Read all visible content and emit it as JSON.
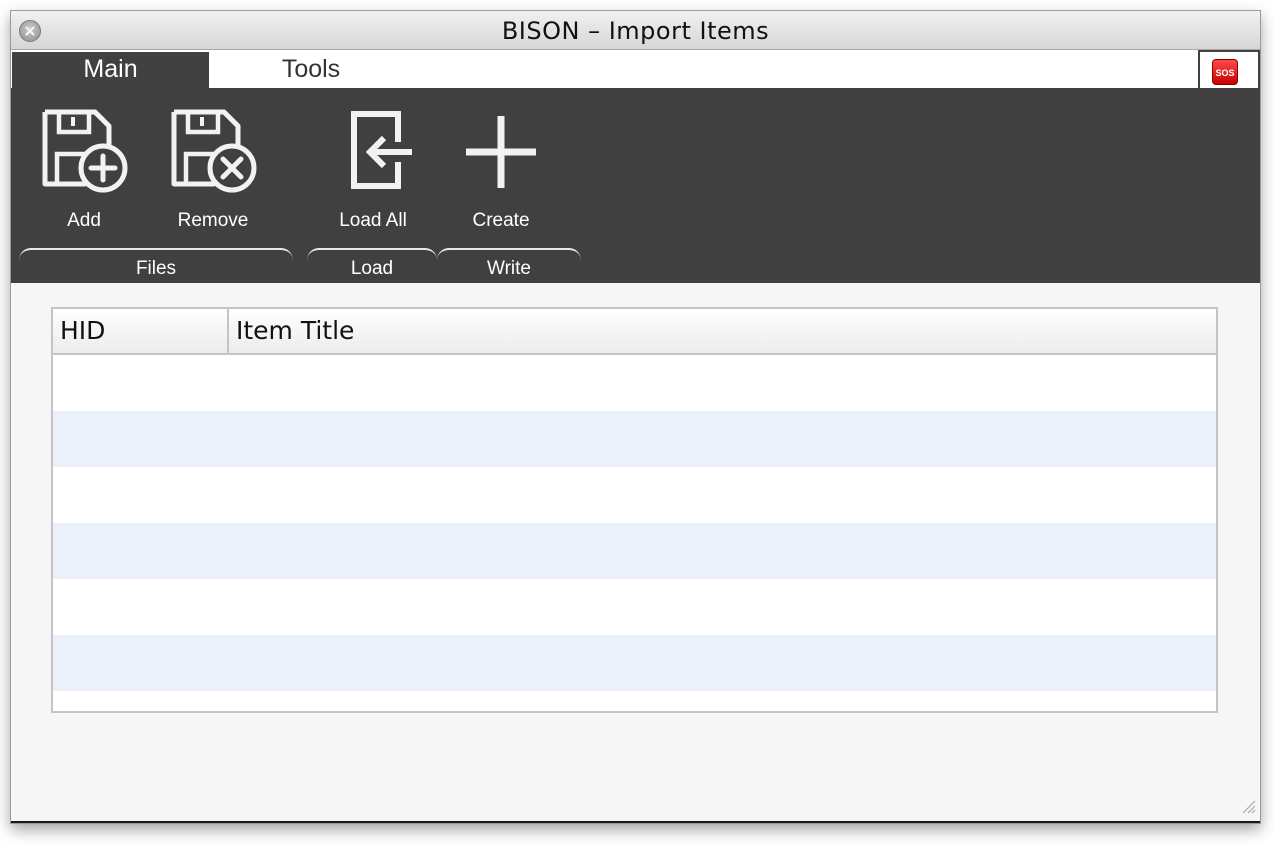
{
  "window": {
    "title": "BISON – Import Items"
  },
  "tabs": [
    {
      "label": "Main",
      "active": true
    },
    {
      "label": "Tools",
      "active": false
    }
  ],
  "sos": {
    "label": "SOS",
    "color": "#e10000"
  },
  "ribbon": {
    "buttons": [
      {
        "label": "Add",
        "icon": "floppy-add-icon"
      },
      {
        "label": "Remove",
        "icon": "floppy-remove-icon"
      },
      {
        "label": "Load All",
        "icon": "load-all-icon"
      },
      {
        "label": "Create",
        "icon": "plus-icon"
      }
    ],
    "groups": [
      {
        "label": "Files"
      },
      {
        "label": "Load"
      },
      {
        "label": "Write"
      }
    ]
  },
  "table": {
    "columns": [
      "HID",
      "Item Title"
    ],
    "rows": [],
    "alt_row_color": "#eaf1fb"
  },
  "colors": {
    "ribbon_bg": "#404040",
    "tab_active_bg": "#414141",
    "window_bg": "#f6f6f6"
  }
}
